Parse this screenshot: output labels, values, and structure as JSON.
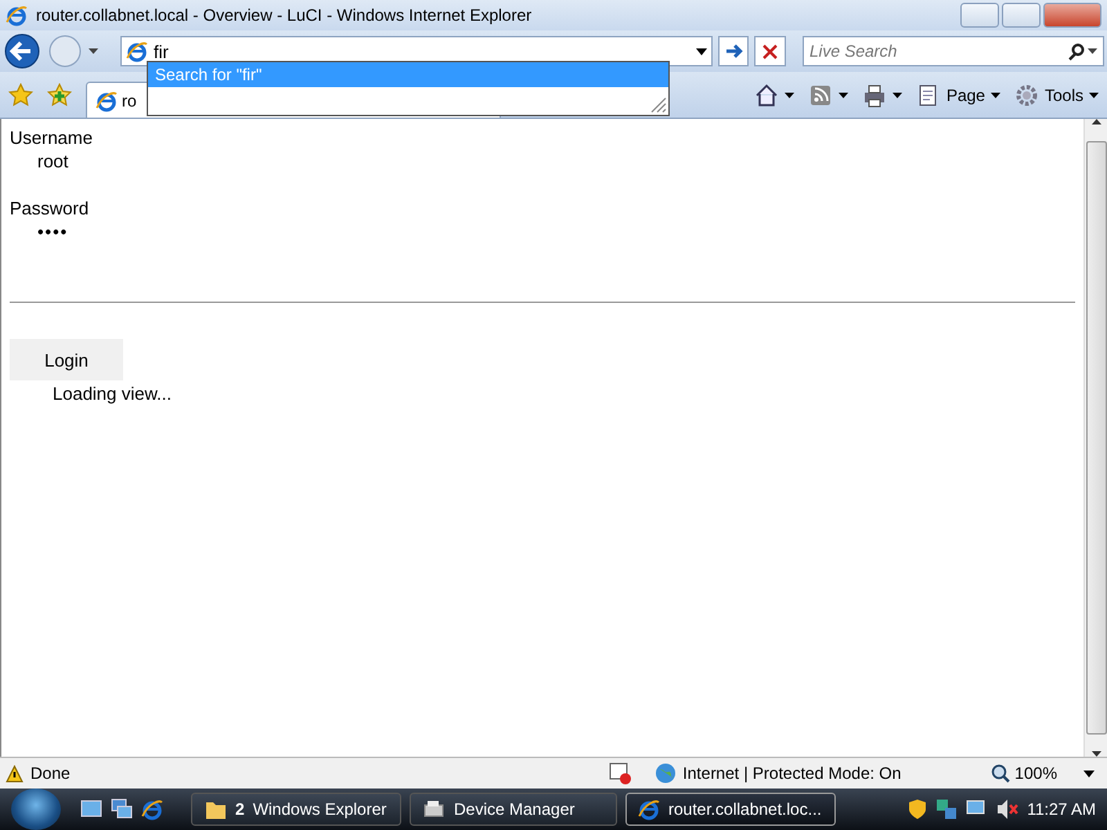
{
  "window": {
    "title": "router.collabnet.local - Overview - LuCI - Windows Internet Explorer"
  },
  "address_bar": {
    "value": "fir",
    "suggestions": [
      {
        "label": "Search for \"fir\"",
        "selected": true
      }
    ]
  },
  "search": {
    "placeholder": "Live Search"
  },
  "tab": {
    "title": "ro"
  },
  "toolbar": {
    "buttons": [
      {
        "kind": "home"
      },
      {
        "kind": "feeds"
      },
      {
        "kind": "print"
      },
      {
        "kind": "page",
        "label": "Page"
      },
      {
        "kind": "tools",
        "label": "Tools"
      }
    ]
  },
  "login": {
    "fields": [
      {
        "label": "Username",
        "value": "root"
      },
      {
        "label": "Password",
        "value": "••••"
      }
    ],
    "button": "Login",
    "status": "Loading view..."
  },
  "status_bar": {
    "text": "Done",
    "zone": "Internet | Protected Mode: On",
    "zoom": "100%"
  },
  "taskbar": {
    "buttons": [
      {
        "count": "2",
        "label": "Windows Explorer",
        "kind": "explorer",
        "selected": false
      },
      {
        "label": "Device Manager",
        "kind": "devices",
        "selected": false
      },
      {
        "label": "router.collabnet.loc...",
        "kind": "ie",
        "selected": true
      }
    ],
    "clock": "11:27 AM"
  }
}
